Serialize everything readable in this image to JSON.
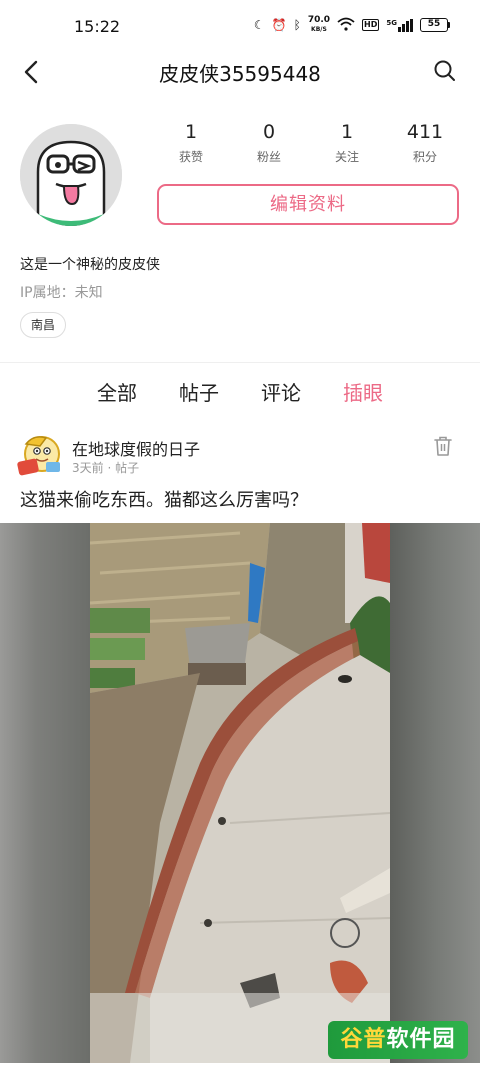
{
  "status_bar": {
    "time": "15:22",
    "net_speed_value": "70.0",
    "net_speed_unit": "KB/S",
    "hd_label": "HD",
    "signal_label": "5G",
    "battery": "55"
  },
  "header": {
    "title": "皮皮侠35595448"
  },
  "profile": {
    "stats": [
      {
        "value": "1",
        "label": "获赞"
      },
      {
        "value": "0",
        "label": "粉丝"
      },
      {
        "value": "1",
        "label": "关注"
      },
      {
        "value": "411",
        "label": "积分"
      }
    ],
    "edit_button": "编辑资料",
    "bio": "这是一个神秘的皮皮侠",
    "ip_location": "IP属地：未知",
    "location_tag": "南昌"
  },
  "tabs": [
    {
      "label": "全部",
      "active": false
    },
    {
      "label": "帖子",
      "active": false
    },
    {
      "label": "评论",
      "active": false
    },
    {
      "label": "插眼",
      "active": true
    }
  ],
  "post": {
    "user": "在地球度假的日子",
    "meta": "3天前 · 帖子",
    "text": "这猫来偷吃东西。猫都这么厉害吗？"
  },
  "watermark": {
    "part1": "谷普",
    "part2": "软件园"
  },
  "colors": {
    "accent": "#ec6a86",
    "watermark_bg": "#2fb24b"
  }
}
